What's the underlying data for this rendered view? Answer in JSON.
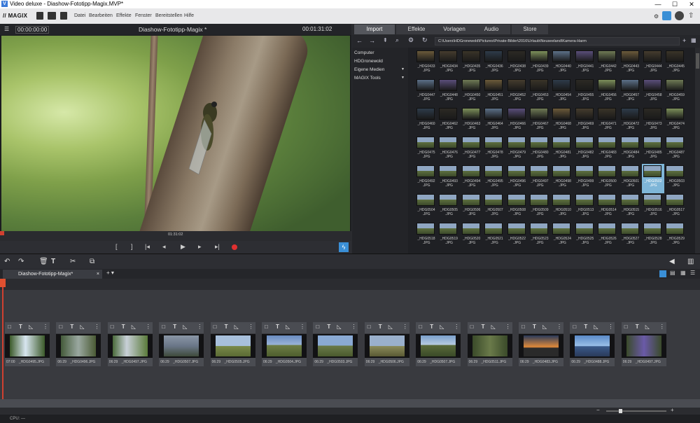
{
  "window": {
    "title": "Video deluxe - Diashow-Fototipp-Magix.MVP*",
    "app_icon": "V"
  },
  "menu": {
    "logo": "// MAGIX",
    "items": [
      "Datei",
      "Bearbeiten",
      "Effekte",
      "Fenster",
      "Bereitstellen",
      "Hilfe"
    ]
  },
  "preview": {
    "timecode_left": "00:00:00:00",
    "title": "Diashow-Fototipp-Magix *",
    "timecode_right": "00:01:31:02",
    "scrub_time": "01:31:02"
  },
  "media": {
    "tabs": [
      "Import",
      "Effekte",
      "Vorlagen",
      "Audio",
      "Store"
    ],
    "active_tab": "Import",
    "path": "C:\\Users\\HDGronewold\\Pictures\\Private-Bilder\\2016\\Urlaub\\Neuseeland\\Kamera-Harm",
    "tree": [
      {
        "label": "Computer",
        "arrow": ""
      },
      {
        "label": "HDGronewold",
        "arrow": ""
      },
      {
        "label": "Eigene Medien",
        "arrow": "▼"
      },
      {
        "label": "MAGIX Tools",
        "arrow": "▼"
      }
    ],
    "rows": [
      [
        "_HDG0433\n.JPG",
        "_HDG0434\n.JPG",
        "_HDG0435\n.JPG",
        "_HDG0436\n.JPG",
        "_HDG0438\n.JPG",
        "_HDG0439\n.JPG",
        "_HDG0440\n.JPG",
        "_HDG0441\n.JPG",
        "_HDG0442\n.JPG",
        "_HDG0443\n.JPG",
        "_HDG0444\n.JPG",
        "_HDG0445\n.JPG"
      ],
      [
        "_HDG0447\n.JPG",
        "_HDG0448\n.JPG",
        "_HDG0450\n.JPG",
        "_HDG0451\n.JPG",
        "_HDG0452\n.JPG",
        "_HDG0453\n.JPG",
        "_HDG0454\n.JPG",
        "_HDG0455\n.JPG",
        "_HDG0456\n.JPG",
        "_HDG0457\n.JPG",
        "_HDG0458\n.JPG",
        "_HDG0459\n.JPG"
      ],
      [
        "_HDG0460\n.JPG",
        "_HDG0462\n.JPG",
        "_HDG0463\n.JPG",
        "_HDG0464\n.JPG",
        "_HDG0466\n.JPG",
        "_HDG0467\n.JPG",
        "_HDG0468\n.JPG",
        "_HDG0469\n.JPG",
        "_HDG0471\n.JPG",
        "_HDG0472\n.JPG",
        "_HDG0473\n.JPG",
        "_HDG0474\n.JPG"
      ],
      [
        "_HDG0475\n.JPG",
        "_HDG0476\n.JPG",
        "_HDG0477\n.JPG",
        "_HDG0478\n.JPG",
        "_HDG0479\n.JPG",
        "_HDG0480\n.JPG",
        "_HDG0481\n.JPG",
        "_HDG0482\n.JPG",
        "_HDG0483\n.JPG",
        "_HDG0484\n.JPG",
        "_HDG0485\n.JPG",
        "_HDG0487\n.JPG"
      ],
      [
        "_HDG0492\n.JPG",
        "_HDG0493\n.JPG",
        "_HDG0494\n.JPG",
        "_HDG0495\n.JPG",
        "_HDG0496\n.JPG",
        "_HDG0497\n.JPG",
        "_HDG0498\n.JPG",
        "_HDG0499\n.JPG",
        "_HDG0500\n.JPG",
        "_HDG0501\n.JPG",
        "_HDG0502\n.JPG",
        "_HDG0503\n.JPG"
      ],
      [
        "_HDG0504\n.JPG",
        "_HDG0505\n.JPG",
        "_HDG0506\n.JPG",
        "_HDG0507\n.JPG",
        "_HDG0508\n.JPG",
        "_HDG0509\n.JPG",
        "_HDG0510\n.JPG",
        "_HDG0513\n.JPG",
        "_HDG0514\n.JPG",
        "_HDG0515\n.JPG",
        "_HDG0516\n.JPG",
        "_HDG0517\n.JPG"
      ],
      [
        "_HDG0518\n.JPG",
        "_HDG0519\n.JPG",
        "_HDG0520\n.JPG",
        "_HDG0521\n.JPG",
        "_HDG0522\n.JPG",
        "_HDG0523\n.JPG",
        "_HDG0524\n.JPG",
        "_HDG0525\n.JPG",
        "_HDG0526\n.JPG",
        "_HDG0527\n.JPG",
        "_HDG0528\n.JPG",
        "_HDG0529\n.JPG"
      ]
    ],
    "selected": "_HDG0502\n.JPG"
  },
  "project": {
    "tab": "Diashow-Fototipp-Magix*",
    "add": "+ ▾"
  },
  "storyboard": {
    "clips": [
      {
        "time": "07:00",
        "file": "_HDG0495.JPG"
      },
      {
        "time": "06:29",
        "file": "_HDG0496.JPG"
      },
      {
        "time": "06:29",
        "file": "_HDG0497.JPG"
      },
      {
        "time": "06:29",
        "file": "_HDG0507.JPG"
      },
      {
        "time": "06:29",
        "file": "_HDG0505.JPG"
      },
      {
        "time": "06:29",
        "file": "_HDG0504.JPG"
      },
      {
        "time": "06:29",
        "file": "_HDG0503.JPG"
      },
      {
        "time": "06:29",
        "file": "_HDG0506.JPG"
      },
      {
        "time": "06:29",
        "file": "_HDG0507.JPG"
      },
      {
        "time": "06:29",
        "file": "_HDG0511.JPG"
      },
      {
        "time": "06:29",
        "file": "_HDG0483.JPG"
      },
      {
        "time": "06:29",
        "file": "_HDG0488.JPG"
      },
      {
        "time": "06:29",
        "file": "_HDG0497.JPG"
      }
    ]
  },
  "status": {
    "cpu": "CPU: —"
  },
  "colors": {
    "accent": "#3a8fd6",
    "playhead": "#d04030",
    "selected": "#7fb6d8"
  }
}
